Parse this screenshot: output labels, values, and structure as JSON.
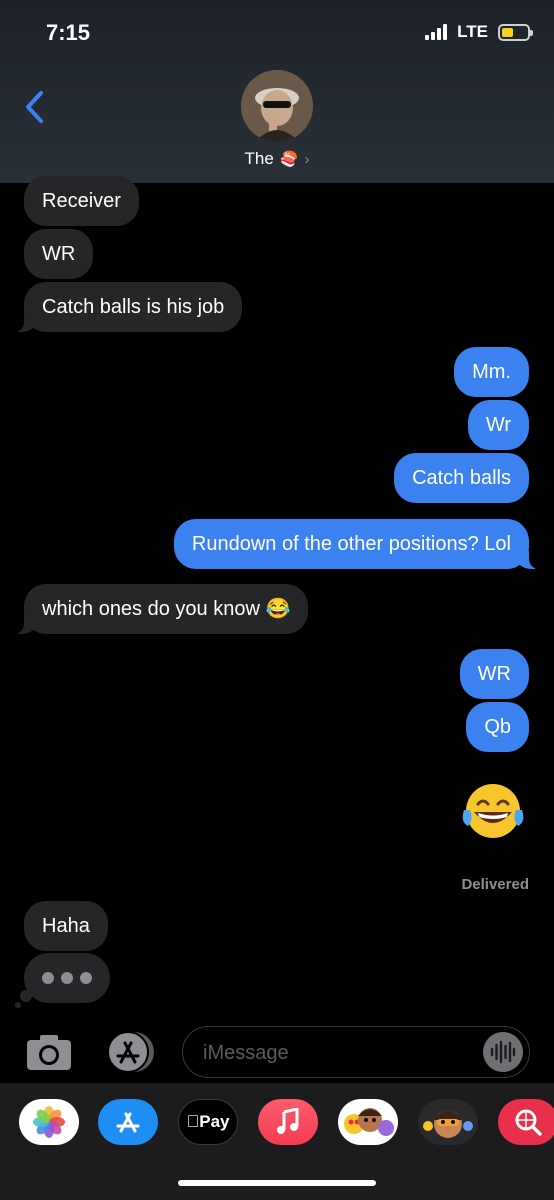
{
  "status_bar": {
    "time": "7:15",
    "network": "LTE"
  },
  "header": {
    "contact_name": "The",
    "contact_emoji": "🍣",
    "chevron": "›"
  },
  "messages": {
    "m1": "Receiver",
    "m2": "WR",
    "m3": "Catch balls is his job",
    "m4": "Mm.",
    "m5": "Wr",
    "m6": "Catch balls",
    "m7": "Rundown of the other positions? Lol",
    "m8": "which ones do you know 😂",
    "m9": "WR",
    "m10": "Qb",
    "m11_emoji": "😂",
    "m12": "Haha"
  },
  "delivered_label": "Delivered",
  "composer": {
    "placeholder": "iMessage"
  },
  "app_drawer": {
    "apple_pay_label": "Pay",
    "apps": [
      "photos-icon",
      "app-store-icon",
      "apple-pay-icon",
      "music-icon",
      "memoji-stickers-icon",
      "memoji-icon",
      "web-search-icon"
    ]
  },
  "colors": {
    "outgoing_bubble": "#3b82f0",
    "incoming_bubble": "#262628",
    "header_bg": "#2a3038",
    "accent_back": "#3b82f0"
  }
}
